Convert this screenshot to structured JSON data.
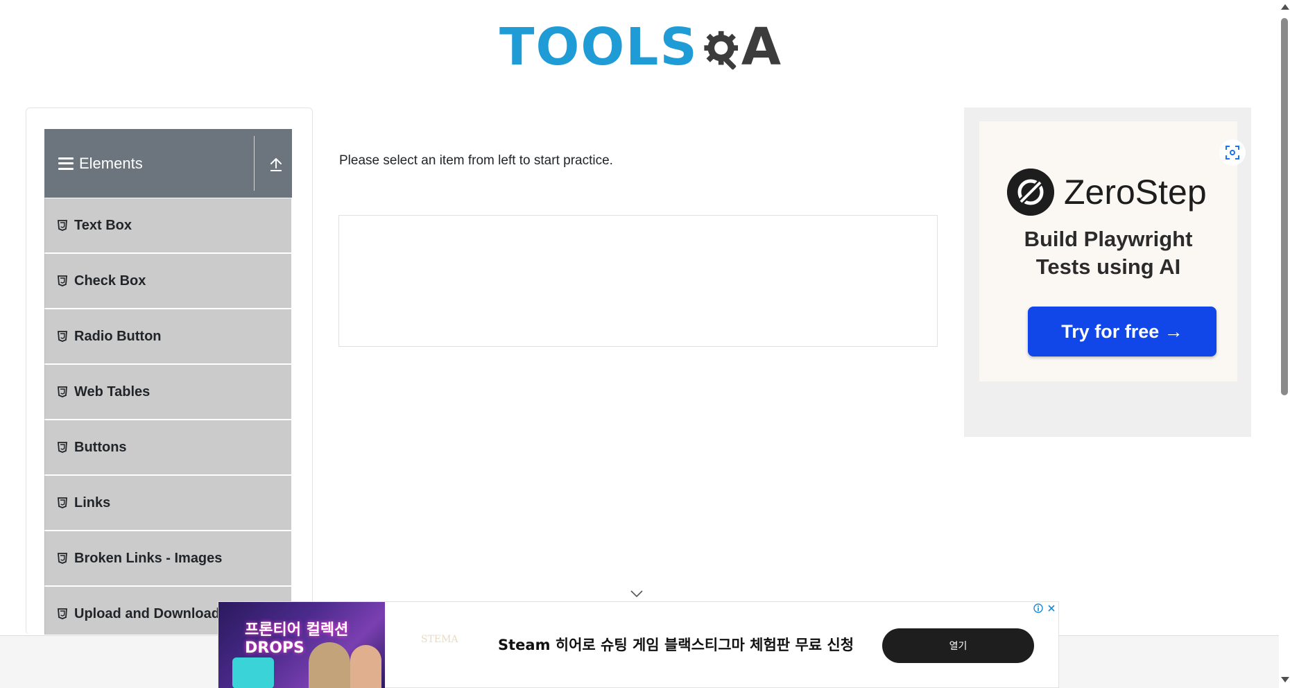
{
  "header": {
    "logo_text_left": "TOOLS",
    "logo_text_right": "A"
  },
  "sidebar": {
    "group_title": "Elements",
    "items": [
      {
        "label": "Text Box"
      },
      {
        "label": "Check Box"
      },
      {
        "label": "Radio Button"
      },
      {
        "label": "Web Tables"
      },
      {
        "label": "Buttons"
      },
      {
        "label": "Links"
      },
      {
        "label": "Broken Links - Images"
      },
      {
        "label": "Upload and Download"
      }
    ]
  },
  "main": {
    "intro_text": "Please select an item from left to start practice."
  },
  "ad_right": {
    "brand": "ZeroStep",
    "headline_line1": "Build Playwright",
    "headline_line2": "Tests using AI",
    "cta_label": "Try for free →"
  },
  "ad_bottom": {
    "image_title": "프론티어 컬렉션 DROPS",
    "brand_text": "STEMA",
    "text": "Steam 히어로 슈팅 게임 블랙스티그마 체험판 무료 신청",
    "button_label": "열기"
  },
  "colors": {
    "logo_blue": "#1f9bd6",
    "group_header_bg": "#6c757d",
    "menu_item_bg": "#cbcbcb",
    "cta_blue": "#1146e8"
  }
}
